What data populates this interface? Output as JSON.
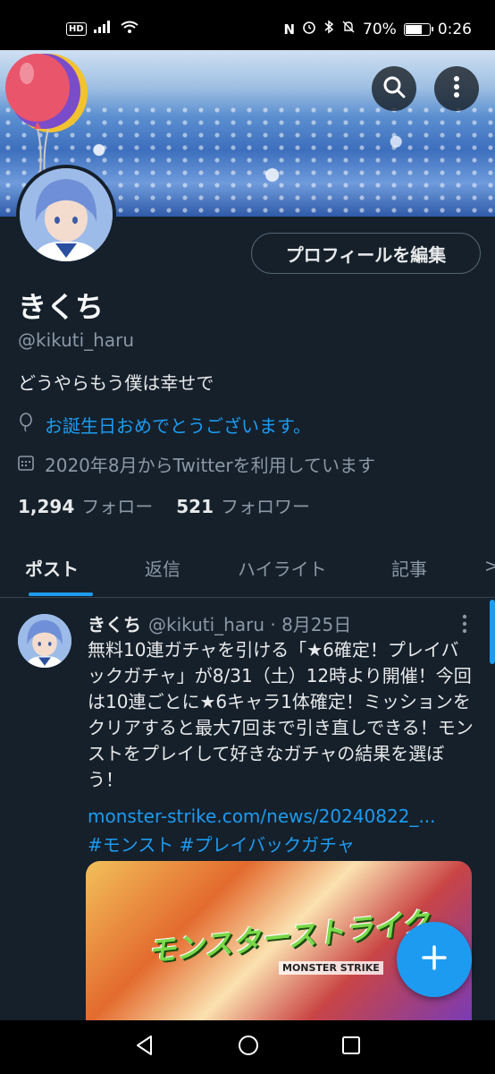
{
  "status_bar": {
    "hd": "HD",
    "signal": "▐▐",
    "wifi": "◠",
    "right_icons": "N ⏰ ✱ Ø",
    "battery": "70%",
    "battery_level": 0.7,
    "time": "0:26"
  },
  "profile": {
    "edit_button": "プロフィールを編集",
    "display_name": "きくち",
    "handle": "@kikuti_haru",
    "bio": "どうやらもう僕は幸せで",
    "birthday_text": "お誕生日おめでとうございます。",
    "joined_text": "2020年8月からTwitterを利用しています",
    "following_count": "1,294",
    "following_label": "フォロー",
    "followers_count": "521",
    "followers_label": "フォロワー"
  },
  "tabs": [
    {
      "label": "ポスト",
      "active": true
    },
    {
      "label": "返信",
      "active": false
    },
    {
      "label": "ハイライト",
      "active": false
    },
    {
      "label": "記事",
      "active": false
    }
  ],
  "tabs_more": ">",
  "post": {
    "author_name": "きくち",
    "author_meta": "@kikuti_haru · 8月25日",
    "text": "無料10連ガチャを引ける「★6確定！プレイバックガチャ」が8/31（土）12時より開催！今回は10連ごとに★6キャラ1体確定！ミッションをクリアすると最大7回まで引き直しできる！モンストをプレイして好きなガチャの結果を選ぼう！",
    "link": "monster-strike.com/news/20240822_...",
    "hashtags": "#モンスト #プレイバックガチャ",
    "image_title": "モンスターストライク",
    "image_subtitle": "MONSTER STRIKE"
  },
  "colors": {
    "background": "#15202b",
    "accent": "#1d9bf0",
    "muted_text": "#8b98a5"
  }
}
